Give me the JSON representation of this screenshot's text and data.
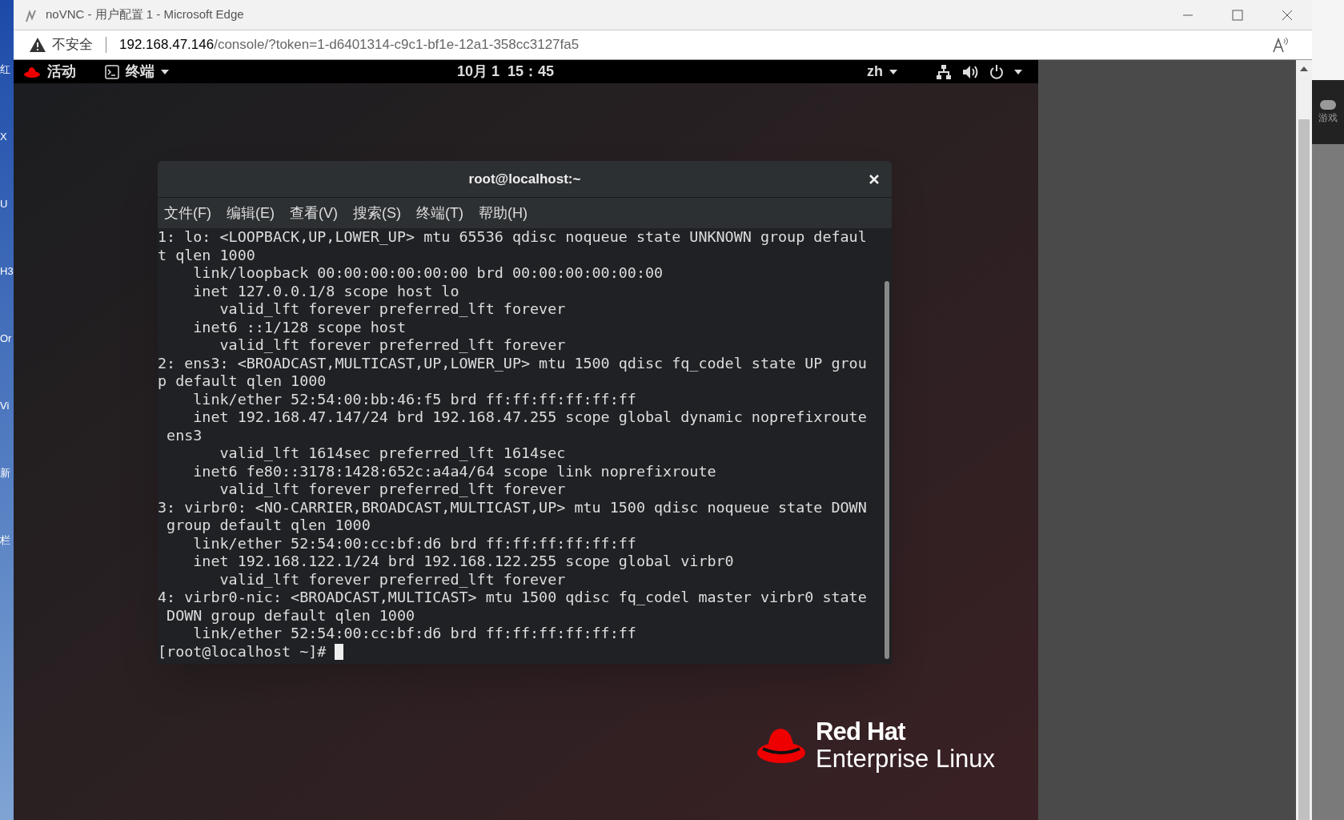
{
  "browser": {
    "title": "noVNC - 用户配置 1 - Microsoft Edge",
    "security": "不安全",
    "url_host": "192.168.47.146",
    "url_path": "/console/?token=1-d6401314-c9c1-bf1e-12a1-358cc3127fa5"
  },
  "desktop_left": [
    "红",
    "X",
    "U",
    "H3",
    "Or",
    "Vi",
    "新",
    "栏"
  ],
  "desktop_right": [
    "游戏"
  ],
  "gnome_bar": {
    "activities": "活动",
    "app": "终端",
    "clock": "10月 1  15：45",
    "lang": "zh"
  },
  "terminal": {
    "title": "root@localhost:~",
    "menu": [
      "文件(F)",
      "编辑(E)",
      "查看(V)",
      "搜索(S)",
      "终端(T)",
      "帮助(H)"
    ],
    "lines": [
      "1: lo: <LOOPBACK,UP,LOWER_UP> mtu 65536 qdisc noqueue state UNKNOWN group defaul",
      "t qlen 1000",
      "    link/loopback 00:00:00:00:00:00 brd 00:00:00:00:00:00",
      "    inet 127.0.0.1/8 scope host lo",
      "       valid_lft forever preferred_lft forever",
      "    inet6 ::1/128 scope host",
      "       valid_lft forever preferred_lft forever",
      "2: ens3: <BROADCAST,MULTICAST,UP,LOWER_UP> mtu 1500 qdisc fq_codel state UP grou",
      "p default qlen 1000",
      "    link/ether 52:54:00:bb:46:f5 brd ff:ff:ff:ff:ff:ff",
      "    inet 192.168.47.147/24 brd 192.168.47.255 scope global dynamic noprefixroute",
      " ens3",
      "       valid_lft 1614sec preferred_lft 1614sec",
      "    inet6 fe80::3178:1428:652c:a4a4/64 scope link noprefixroute",
      "       valid_lft forever preferred_lft forever",
      "3: virbr0: <NO-CARRIER,BROADCAST,MULTICAST,UP> mtu 1500 qdisc noqueue state DOWN",
      " group default qlen 1000",
      "    link/ether 52:54:00:cc:bf:d6 brd ff:ff:ff:ff:ff:ff",
      "    inet 192.168.122.1/24 brd 192.168.122.255 scope global virbr0",
      "       valid_lft forever preferred_lft forever",
      "4: virbr0-nic: <BROADCAST,MULTICAST> mtu 1500 qdisc fq_codel master virbr0 state",
      " DOWN group default qlen 1000",
      "    link/ether 52:54:00:cc:bf:d6 brd ff:ff:ff:ff:ff:ff"
    ],
    "prompt": "[root@localhost ~]# "
  },
  "logo": {
    "line1": "Red Hat",
    "line2": "Enterprise Linux"
  }
}
